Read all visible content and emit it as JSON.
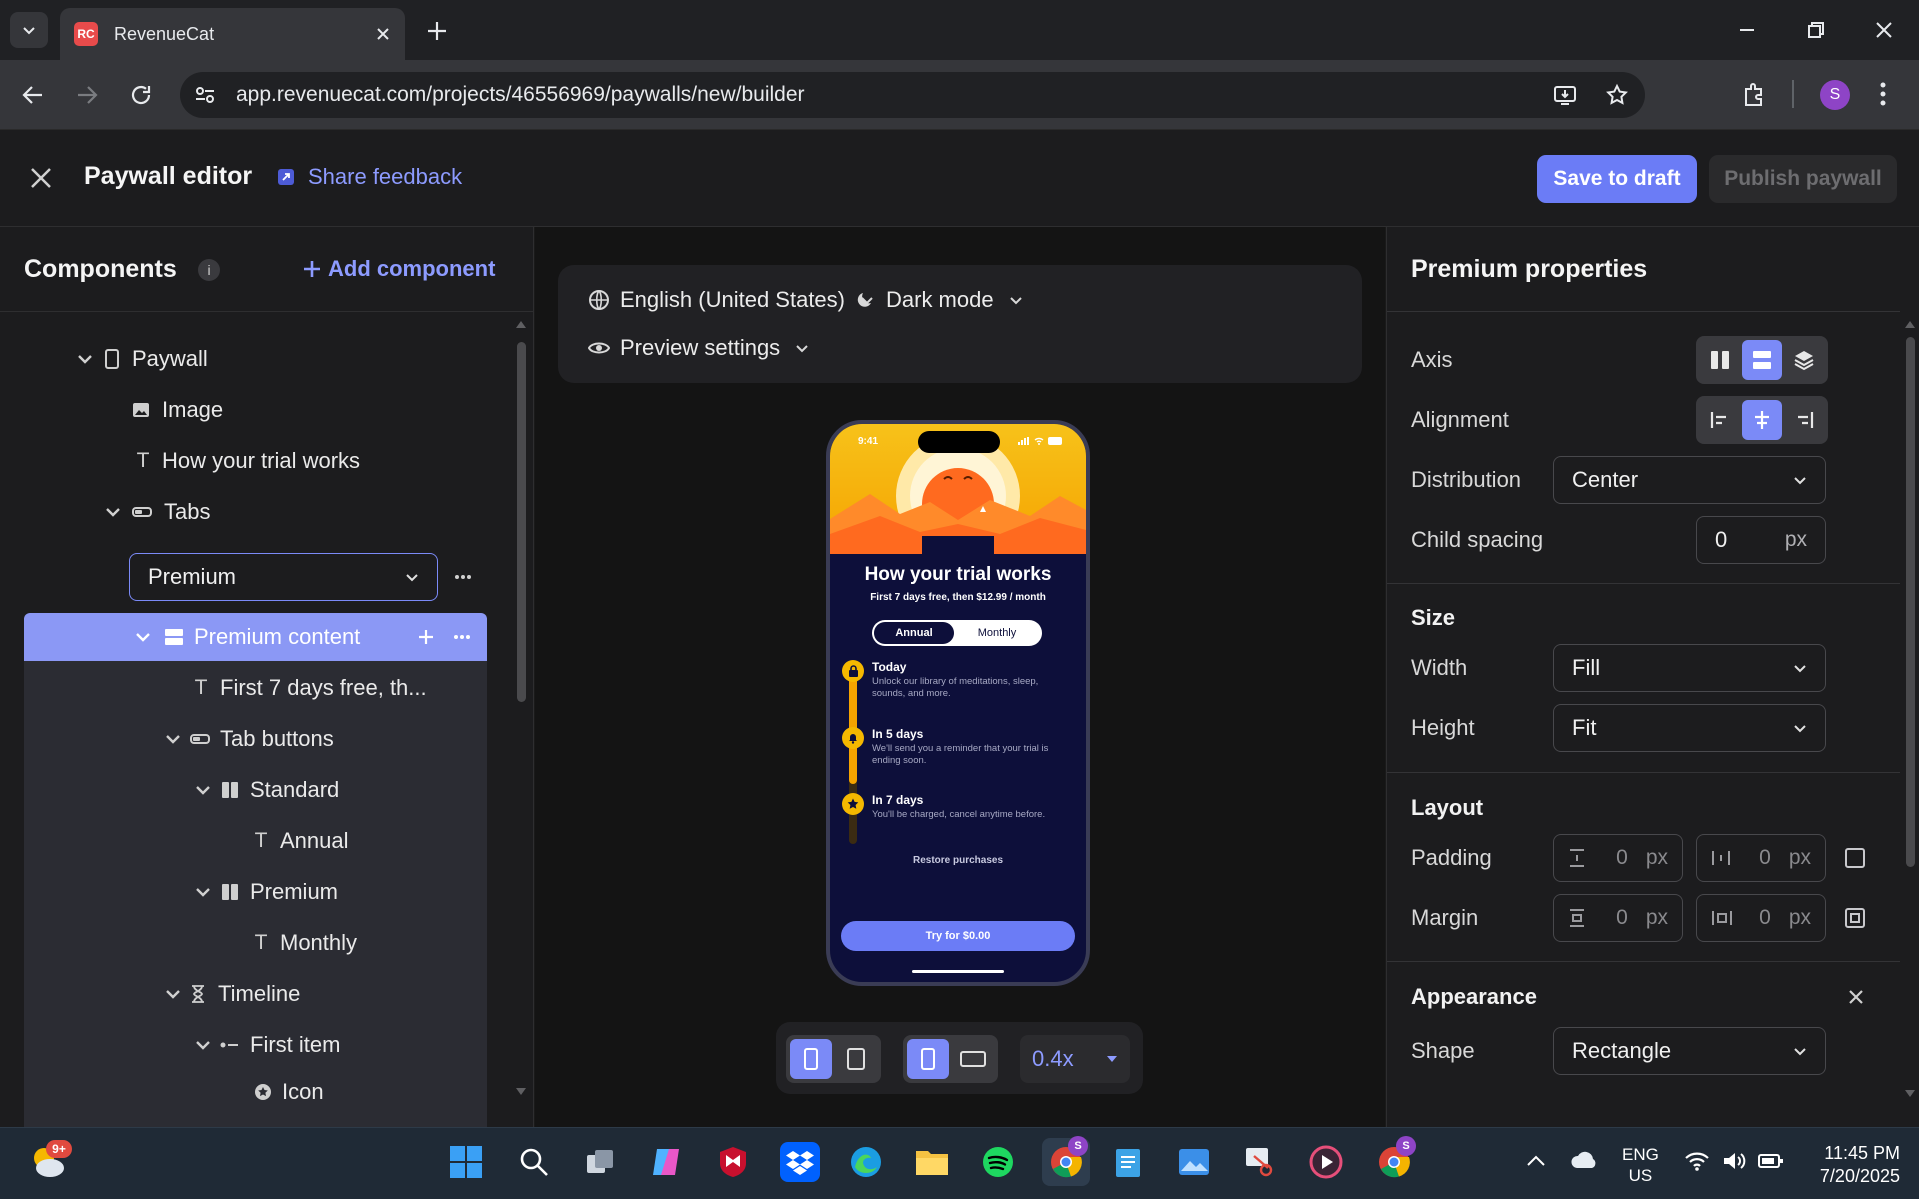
{
  "browser": {
    "tab_title": "RevenueCat",
    "favicon_text": "RC",
    "url": "app.revenuecat.com/projects/46556969/paywalls/new/builder",
    "profile_initial": "S"
  },
  "header": {
    "title": "Paywall editor",
    "share_feedback": "Share feedback",
    "save_draft": "Save to draft",
    "publish": "Publish paywall"
  },
  "components": {
    "title": "Components",
    "add_label": "Add component",
    "tabs_select_value": "Premium",
    "tree": [
      {
        "label": "Paywall"
      },
      {
        "label": "Image"
      },
      {
        "label": "How your trial works"
      },
      {
        "label": "Tabs"
      },
      {
        "label": "Premium content"
      },
      {
        "label": "First 7 days free, th..."
      },
      {
        "label": "Tab buttons"
      },
      {
        "label": "Standard"
      },
      {
        "label": "Annual"
      },
      {
        "label": "Premium"
      },
      {
        "label": "Monthly"
      },
      {
        "label": "Timeline"
      },
      {
        "label": "First item"
      },
      {
        "label": "Icon"
      }
    ]
  },
  "center": {
    "language": "English (United States)",
    "mode": "Dark mode",
    "preview": "Preview settings",
    "zoom": "0.4x"
  },
  "phone": {
    "time": "9:41",
    "title": "How your trial works",
    "subtitle": "First 7 days free, then $12.99 / month",
    "tab_annual": "Annual",
    "tab_monthly": "Monthly",
    "steps": [
      {
        "title": "Today",
        "desc": "Unlock our library of meditations, sleep, sounds, and more."
      },
      {
        "title": "In 5 days",
        "desc": "We'll send you a reminder that your trial is ending soon."
      },
      {
        "title": "In 7 days",
        "desc": "You'll be charged, cancel anytime before."
      }
    ],
    "restore": "Restore purchases",
    "cta": "Try for $0.00"
  },
  "properties": {
    "title": "Premium properties",
    "axis": "Axis",
    "alignment": "Alignment",
    "distribution": "Distribution",
    "distribution_value": "Center",
    "child_spacing": "Child spacing",
    "child_spacing_value": "0",
    "unit": "px",
    "size": "Size",
    "width": "Width",
    "width_value": "Fill",
    "height": "Height",
    "height_value": "Fit",
    "layout": "Layout",
    "padding": "Padding",
    "padding_v": "0",
    "padding_h": "0",
    "margin": "Margin",
    "margin_v": "0",
    "margin_h": "0",
    "appearance": "Appearance",
    "shape": "Shape",
    "shape_value": "Rectangle"
  },
  "taskbar": {
    "weather_badge": "9+",
    "lang_top": "ENG",
    "lang_bottom": "US",
    "time": "11:45 PM",
    "date": "7/20/2025",
    "chrome_badge": "S"
  },
  "colors": {
    "accent": "#6b7cf6",
    "selected": "#8b98f5",
    "phone_bg": "#0d0f3a",
    "sun": "#f5a300"
  }
}
